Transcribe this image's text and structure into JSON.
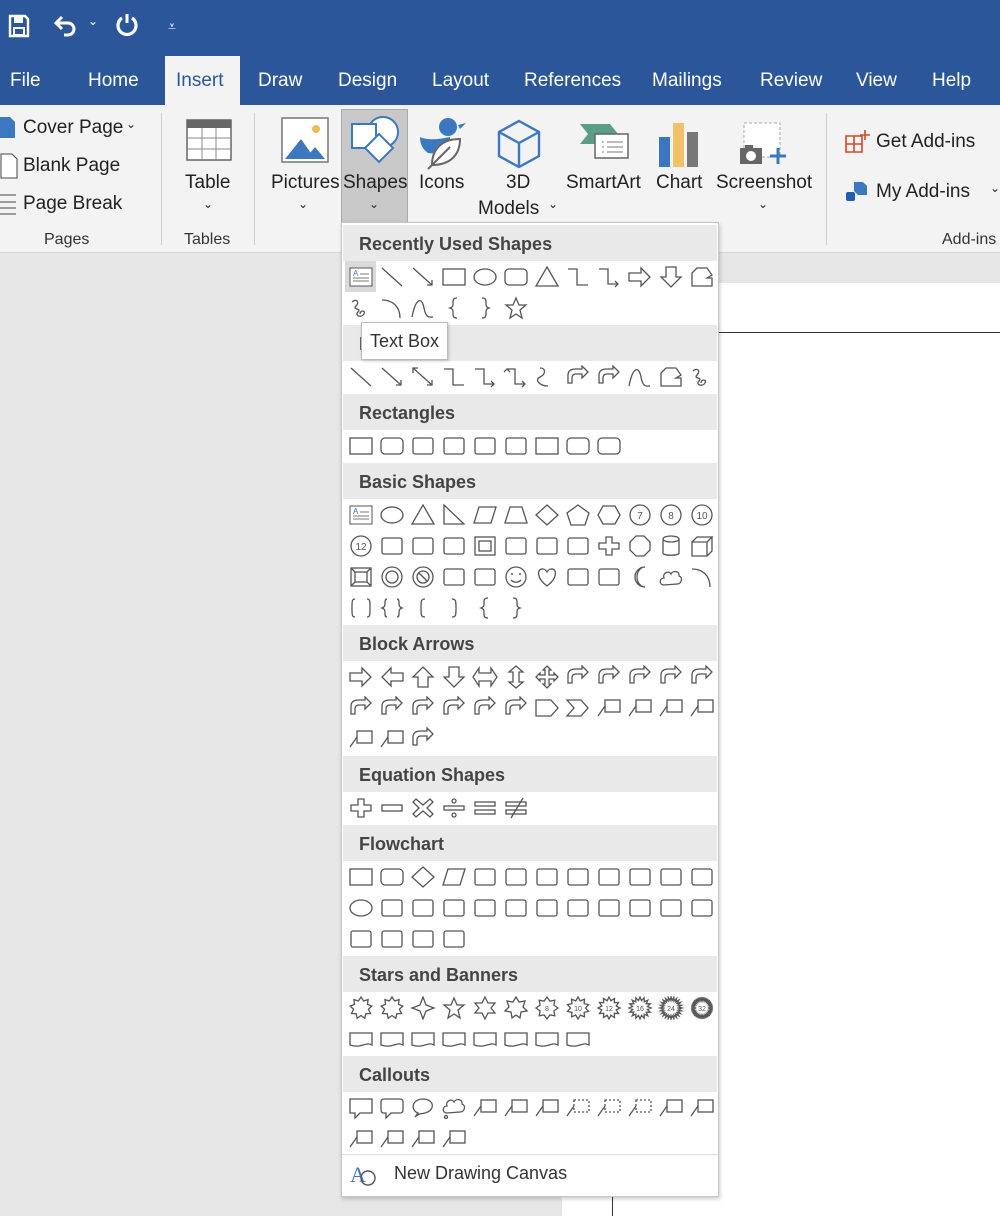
{
  "quick_access": {
    "save_icon": "save-icon",
    "undo_icon": "undo-icon",
    "redo_icon": "redo-icon",
    "customize_icon": "customize-icon"
  },
  "tabs": [
    "File",
    "Home",
    "Insert",
    "Draw",
    "Design",
    "Layout",
    "References",
    "Mailings",
    "Review",
    "View",
    "Help"
  ],
  "active_tab": "Insert",
  "ribbon": {
    "pages": {
      "items": [
        "Cover Page",
        "Blank Page",
        "Page Break"
      ],
      "label": "Pages"
    },
    "tables": {
      "table": "Table",
      "label": "Tables"
    },
    "illustrations": {
      "pictures": "Pictures",
      "shapes": "Shapes",
      "icons": "Icons",
      "models_line1": "3D",
      "models_line2": "Models",
      "smartart": "SmartArt",
      "chart": "Chart",
      "screenshot": "Screenshot"
    },
    "addins": {
      "get": "Get Add-ins",
      "my": "My Add-ins",
      "label": "Add-ins"
    }
  },
  "colors": {
    "brand": "#2b579a",
    "accent_blue": "#3c78c0",
    "addin_orange": "#d24726"
  },
  "shapes_menu": {
    "tooltip": "Text Box",
    "sections": [
      {
        "title": "Recently Used Shapes",
        "rows": [
          [
            "textbox",
            "line",
            "arrow-line",
            "rect",
            "ellipse",
            "rounded-rect",
            "triangle",
            "elbow",
            "elbow-arrow",
            "right-arrow",
            "down-arrow",
            "freeform"
          ],
          [
            "scribble",
            "arc",
            "curve",
            "brace-left",
            "brace-right",
            "star5"
          ]
        ]
      },
      {
        "title": "Lines",
        "rows": [
          [
            "line",
            "arrow-line",
            "double-arrow-line",
            "elbow",
            "elbow-arrow",
            "elbow-double-arrow",
            "curve-connector",
            "curve-arrow",
            "curve-double-arrow",
            "curve",
            "freeform",
            "scribble"
          ]
        ]
      },
      {
        "title": "Rectangles",
        "rows": [
          [
            "rect",
            "rounded-rect",
            "snip-rect",
            "snip2-rect",
            "round-snip-rect",
            "round-corner-rect",
            "rect",
            "rounded-rect",
            "rounded-rect"
          ]
        ]
      },
      {
        "title": "Basic Shapes",
        "rows": [
          [
            "textbox",
            "ellipse",
            "triangle",
            "right-triangle",
            "parallelogram",
            "trapezoid",
            "diamond",
            "pentagon",
            "hexagon",
            "heptagon-7",
            "octagon-8",
            "decagon-10"
          ],
          [
            "dodecagon-12",
            "pie",
            "chord",
            "teardrop",
            "frame",
            "half-frame",
            "l-shape",
            "diagonal-stripe",
            "cross",
            "octagon",
            "can",
            "cube"
          ],
          [
            "bevel",
            "donut",
            "no-symbol",
            "block-arc",
            "folded-corner",
            "smiley",
            "heart",
            "lightning",
            "sun",
            "moon",
            "cloud",
            "arc"
          ],
          [
            "bracket-pair",
            "brace-pair",
            "bracket-left",
            "bracket-right",
            "brace-left",
            "brace-right"
          ]
        ]
      },
      {
        "title": "Block Arrows",
        "rows": [
          [
            "right-arrow",
            "left-arrow",
            "up-arrow",
            "down-arrow",
            "left-right-arrow",
            "up-down-arrow",
            "quad-arrow",
            "left-right-up-arrow",
            "bent-arrow",
            "u-turn-arrow",
            "left-up-arrow",
            "bent-up-arrow"
          ],
          [
            "curved-right-arrow",
            "curved-left-arrow",
            "curved-up-arrow",
            "curved-down-arrow",
            "striped-right-arrow",
            "notched-right-arrow",
            "pentagon-arrow",
            "chevron",
            "right-arrow-callout",
            "down-arrow-callout",
            "left-arrow-callout",
            "up-arrow-callout"
          ],
          [
            "left-right-arrow-callout",
            "quad-arrow-callout",
            "circular-arrow"
          ]
        ]
      },
      {
        "title": "Equation Shapes",
        "rows": [
          [
            "plus",
            "minus",
            "multiply",
            "divide",
            "equal",
            "not-equal"
          ]
        ]
      },
      {
        "title": "Flowchart",
        "rows": [
          [
            "rect",
            "rounded-rect",
            "diamond",
            "parallelogram",
            "predefined-process",
            "internal-storage",
            "document",
            "multidocument",
            "terminator",
            "preparation",
            "manual-input",
            "manual-operation"
          ],
          [
            "ellipse",
            "offpage-connector",
            "card",
            "punched-tape",
            "summing-junction",
            "or",
            "collate",
            "sort",
            "extract",
            "merge",
            "stored-data",
            "delay"
          ],
          [
            "sequential-storage",
            "magnetic-disk",
            "direct-access-storage",
            "display"
          ]
        ]
      },
      {
        "title": "Stars and Banners",
        "rows": [
          [
            "explosion1",
            "explosion2",
            "star4",
            "star5",
            "star6",
            "star7",
            "star8",
            "star10",
            "star12",
            "star16",
            "star24",
            "star32"
          ],
          [
            "ribbon-up",
            "ribbon-down",
            "curved-ribbon-up",
            "curved-ribbon-down",
            "vertical-scroll",
            "horizontal-scroll",
            "wave",
            "double-wave"
          ]
        ]
      },
      {
        "title": "Callouts",
        "rows": [
          [
            "rect-callout",
            "rounded-rect-callout",
            "oval-callout",
            "cloud-callout",
            "line-callout1",
            "line-callout2",
            "line-callout3",
            "line-callout1-noborder",
            "line-callout2-noborder",
            "line-callout3-noborder",
            "line-callout1-accent",
            "line-callout2-accent"
          ],
          [
            "line-callout3-accent",
            "line-callout1-border",
            "line-callout2-border",
            "line-callout3-border"
          ]
        ]
      }
    ],
    "new_canvas": "New Drawing Canvas",
    "new_canvas_icon": "drawing-canvas-icon"
  }
}
